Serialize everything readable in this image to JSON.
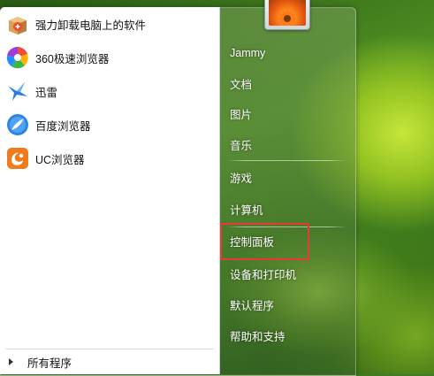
{
  "programs": [
    {
      "label": "强力卸载电脑上的软件",
      "icon": "uninstaller-box-icon"
    },
    {
      "label": "360极速浏览器",
      "icon": "360-browser-icon"
    },
    {
      "label": "迅雷",
      "icon": "thunder-bird-icon"
    },
    {
      "label": "百度浏览器",
      "icon": "baidu-browser-icon"
    },
    {
      "label": "UC浏览器",
      "icon": "uc-browser-icon"
    }
  ],
  "all_programs_label": "所有程序",
  "right_items": {
    "user": "Jammy",
    "documents": "文档",
    "pictures": "图片",
    "music": "音乐",
    "games": "游戏",
    "computer": "计算机",
    "control_panel": "控制面板",
    "devices_printers": "设备和打印机",
    "default_programs": "默认程序",
    "help_support": "帮助和支持"
  },
  "colors": {
    "highlight_border": "#e8393a",
    "wallpaper_green": "#4f8f22"
  }
}
